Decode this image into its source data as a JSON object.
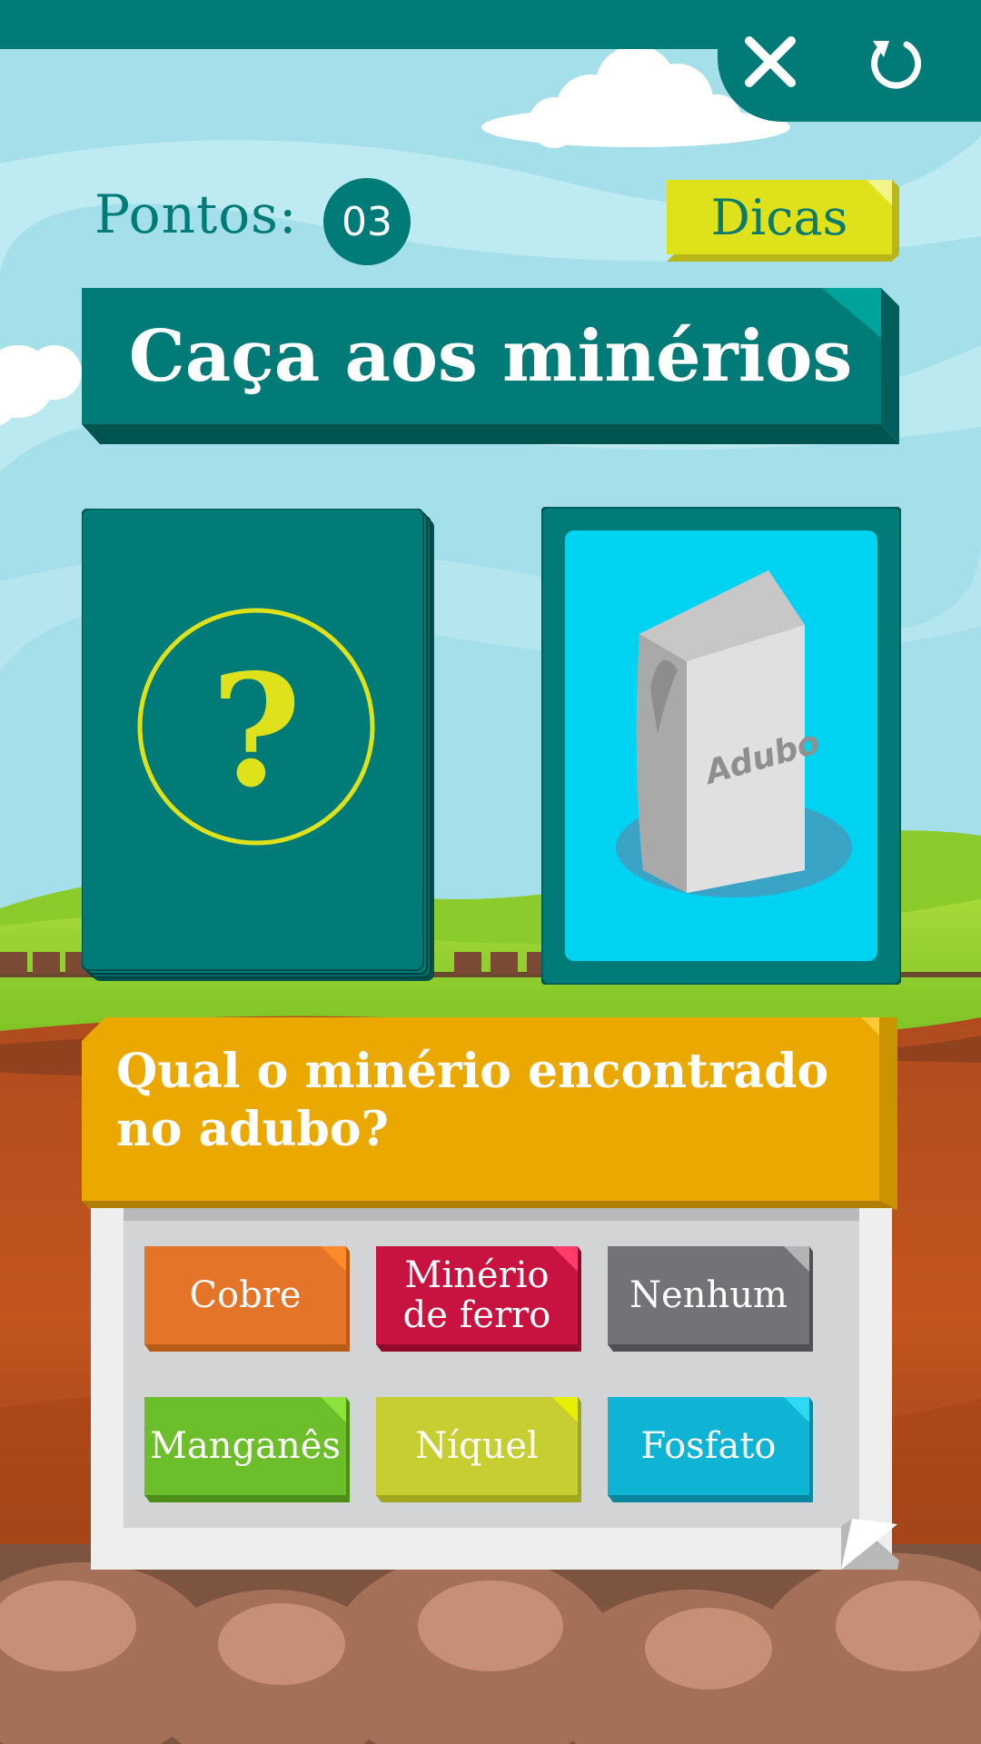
{
  "header": {
    "points_label": "Pontos:",
    "points_value": "03",
    "tips_label": "Dicas",
    "reload_icon": "reload-icon",
    "close_icon": "close-icon"
  },
  "game": {
    "title": "Caça aos minérios",
    "mystery_card_symbol": "?",
    "answer_card_item_label": "Adubo"
  },
  "question": {
    "text": "Qual o minério encontrado no adubo?"
  },
  "options": [
    {
      "label_lines": [
        "Cobre"
      ],
      "color": "#e37428",
      "shade": "#b85a18",
      "tip": "#ff8a2b"
    },
    {
      "label_lines": [
        "Minério",
        "de ferro"
      ],
      "color": "#c8123f",
      "shade": "#94082b",
      "tip": "#ff3d6b"
    },
    {
      "label_lines": [
        "Nenhum"
      ],
      "color": "#727376",
      "shade": "#4f5052",
      "tip": "#b3b4b6"
    },
    {
      "label_lines": [
        "Manganês"
      ],
      "color": "#6cbf2a",
      "shade": "#4c8d18",
      "tip": "#8ee33a"
    },
    {
      "label_lines": [
        "Níquel"
      ],
      "color": "#c7ce31",
      "shade": "#a1a71c",
      "tip": "#e6f000"
    },
    {
      "label_lines": [
        "Fosfato"
      ],
      "color": "#0fb3d4",
      "shade": "#0a86a1",
      "tip": "#2fd9f4"
    }
  ],
  "colors": {
    "primary_teal": "#007b77",
    "accent_yellow": "#dfe21a",
    "question_orange": "#eaa800",
    "card_cyan": "#00d2f1"
  }
}
